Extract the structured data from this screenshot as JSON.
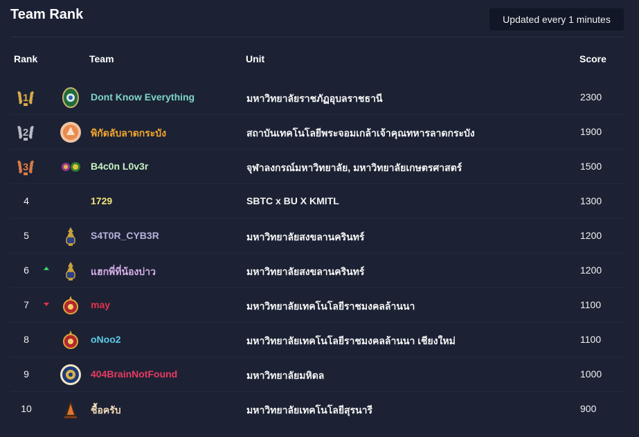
{
  "header": {
    "title": "Team Rank",
    "updated_label": "Updated every 1 minutes"
  },
  "columns": {
    "rank": "Rank",
    "team": "Team",
    "unit": "Unit",
    "score": "Score"
  },
  "colors": {
    "background": "#1c2234",
    "gold": "#d8a94b",
    "silver": "#b9bcc4",
    "bronze": "#d87a45",
    "trend_up": "#37d66b",
    "trend_down": "#e1324b"
  },
  "rows": [
    {
      "rank": "1",
      "medal": "gold-medal-icon",
      "team": "Dont Know Everything",
      "team_color": "#7fd6c8",
      "unit": "มหาวิทยาลัยราชภัฏอุบลราชธานี",
      "score": "2300",
      "logo": "university-seal-green-icon",
      "trend": ""
    },
    {
      "rank": "2",
      "medal": "silver-medal-icon",
      "team": "พิกัดลับลาดกระบัง",
      "team_color": "#f4a72c",
      "unit": "สถาบันเทคโนโลยีพระจอมเกล้าเจ้าคุณทหารลาดกระบัง",
      "score": "1900",
      "logo": "university-seal-orange-icon",
      "trend": ""
    },
    {
      "rank": "3",
      "medal": "bronze-medal-icon",
      "team": "B4c0n L0v3r",
      "team_color": "#c8f2c2",
      "unit": "จุฬาลงกรณ์มหาวิทยาลัย, มหาวิทยาลัยเกษตรศาสตร์",
      "score": "1500",
      "logo": "dual-university-seal-icon",
      "trend": ""
    },
    {
      "rank": "4",
      "medal": "",
      "team": "1729",
      "team_color": "#f1e27a",
      "unit": "SBTC x BU X KMITL",
      "score": "1300",
      "logo": "",
      "trend": ""
    },
    {
      "rank": "5",
      "medal": "",
      "team": "S4T0R_CYB3R",
      "team_color": "#b6b2dc",
      "unit": "มหาวิทยาลัยสงขลานครินทร์",
      "score": "1200",
      "logo": "university-seal-blue-gold-icon",
      "trend": ""
    },
    {
      "rank": "6",
      "medal": "",
      "team": "แฮกพี่ที่น้องบ่าว",
      "team_color": "#d9b0e8",
      "unit": "มหาวิทยาลัยสงขลานครินทร์",
      "score": "1200",
      "logo": "university-seal-blue-gold-icon",
      "trend": "up"
    },
    {
      "rank": "7",
      "medal": "",
      "team": "may",
      "team_color": "#e1324b",
      "unit": "มหาวิทยาลัยเทคโนโลยีราชมงคลล้านนา",
      "score": "1100",
      "logo": "university-seal-red-gold-icon",
      "trend": "down"
    },
    {
      "rank": "8",
      "medal": "",
      "team": "oNoo2",
      "team_color": "#5ecbe8",
      "unit": "มหาวิทยาลัยเทคโนโลยีราชมงคลล้านนา เชียงใหม่",
      "score": "1100",
      "logo": "university-seal-red-gold-icon",
      "trend": ""
    },
    {
      "rank": "9",
      "medal": "",
      "team": "404BrainNotFound",
      "team_color": "#e93b63",
      "unit": "มหาวิทยาลัยมหิดล",
      "score": "1000",
      "logo": "university-seal-round-blue-icon",
      "trend": ""
    },
    {
      "rank": "10",
      "medal": "",
      "team": "ชื้อครับ",
      "team_color": "#f4dcb8",
      "unit": "มหาวิทยาลัยเทคโนโลยีสุรนารี",
      "score": "900",
      "logo": "university-seal-dark-orange-icon",
      "trend": ""
    }
  ]
}
